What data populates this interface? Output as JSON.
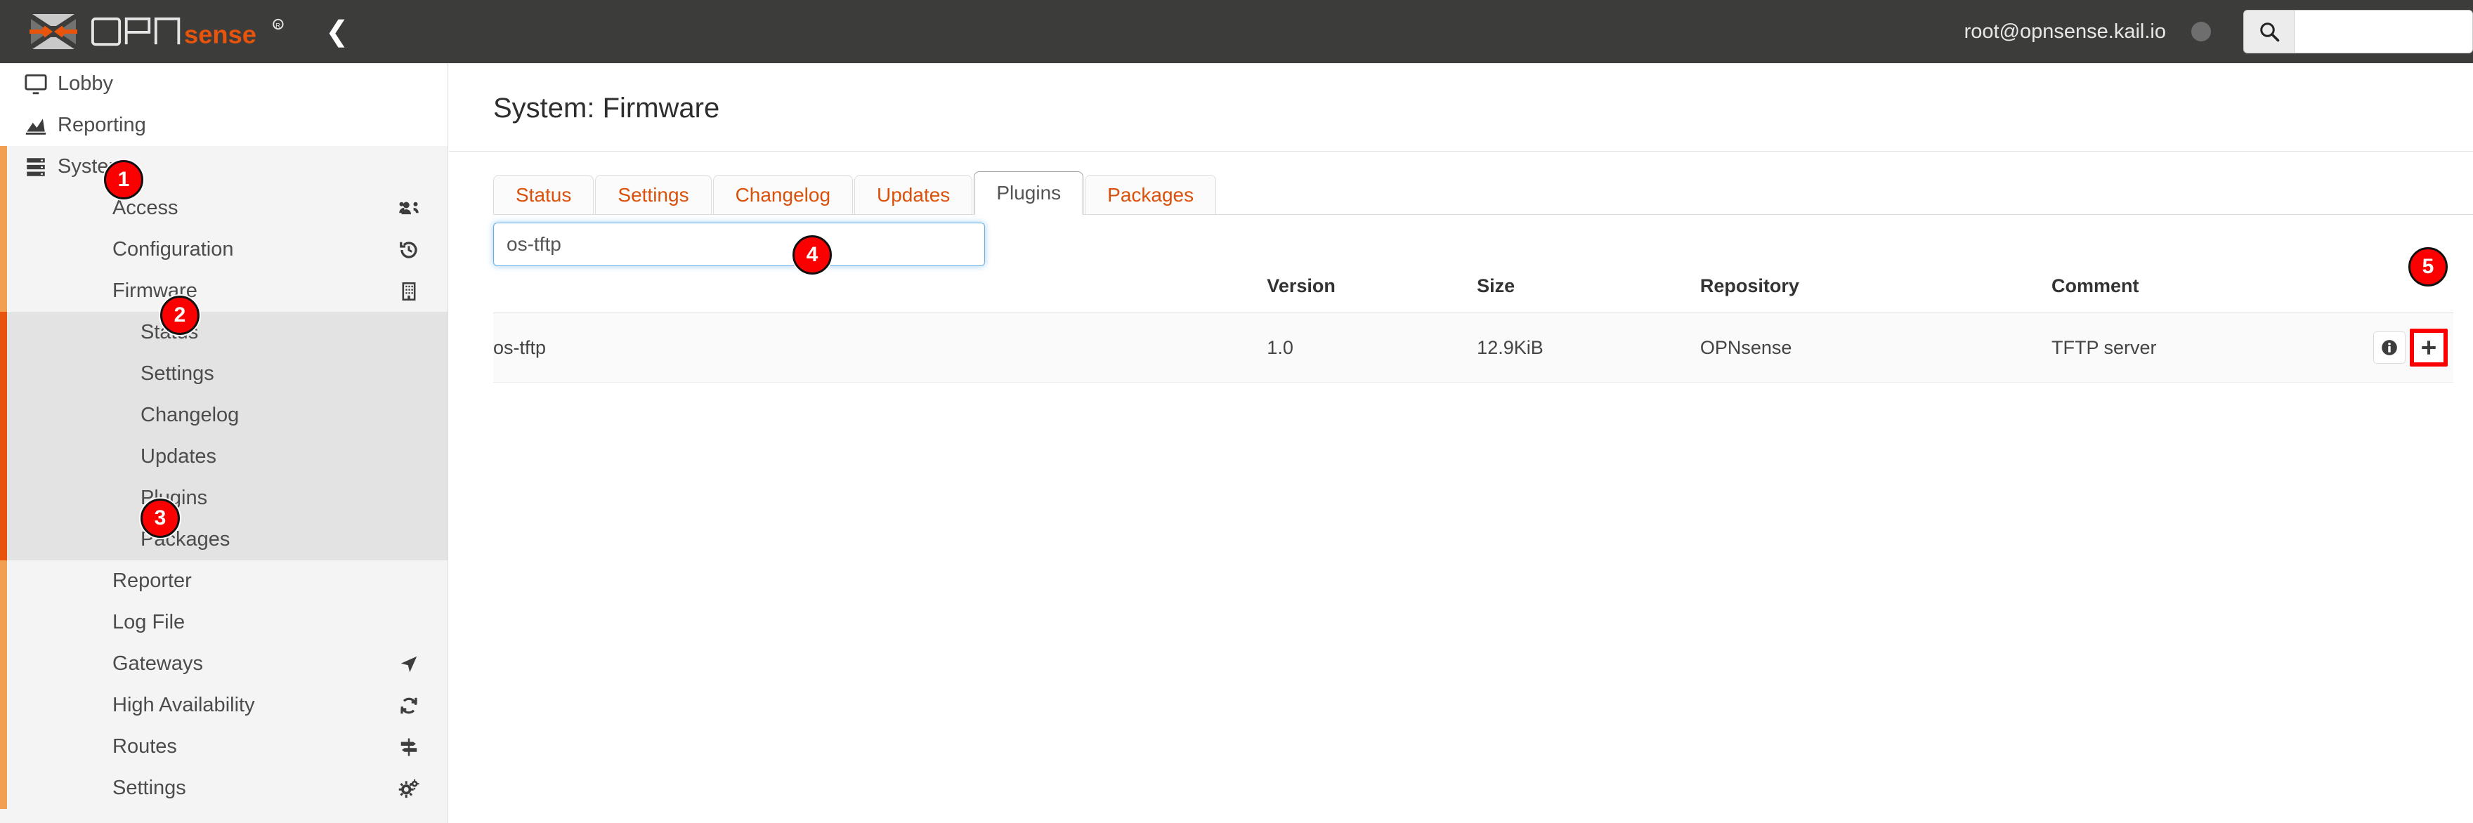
{
  "header": {
    "brand_opn": "OPN",
    "brand_sense": "sense",
    "brand_reg": "®",
    "collapse_icon": "chevron-left-icon",
    "user": "root@opnsense.kail.io",
    "status_indicator": "status-dot",
    "search_icon": "search-icon",
    "search_value": "",
    "search_placeholder": ""
  },
  "sidebar": {
    "items": [
      {
        "label": "Lobby",
        "level": 0,
        "icon": "desktop-icon",
        "right_icon": "",
        "bg": "white",
        "accent": "none"
      },
      {
        "label": "Reporting",
        "level": 0,
        "icon": "chart-area-icon",
        "right_icon": "",
        "bg": "white",
        "accent": "none"
      },
      {
        "label": "System",
        "level": 0,
        "icon": "server-icon",
        "right_icon": "",
        "bg": "section",
        "accent": "light"
      },
      {
        "label": "Access",
        "level": 1,
        "icon": "",
        "right_icon": "users-icon",
        "bg": "section",
        "accent": "light"
      },
      {
        "label": "Configuration",
        "level": 1,
        "icon": "",
        "right_icon": "history-icon",
        "bg": "section",
        "accent": "light"
      },
      {
        "label": "Firmware",
        "level": 1,
        "icon": "",
        "right_icon": "building-icon",
        "bg": "section",
        "accent": "light"
      },
      {
        "label": "Status",
        "level": 2,
        "icon": "",
        "right_icon": "",
        "bg": "sub",
        "accent": "strong"
      },
      {
        "label": "Settings",
        "level": 2,
        "icon": "",
        "right_icon": "",
        "bg": "sub",
        "accent": "strong"
      },
      {
        "label": "Changelog",
        "level": 2,
        "icon": "",
        "right_icon": "",
        "bg": "sub",
        "accent": "strong"
      },
      {
        "label": "Updates",
        "level": 2,
        "icon": "",
        "right_icon": "",
        "bg": "sub",
        "accent": "strong"
      },
      {
        "label": "Plugins",
        "level": 2,
        "icon": "",
        "right_icon": "",
        "bg": "sub",
        "accent": "strong"
      },
      {
        "label": "Packages",
        "level": 2,
        "icon": "",
        "right_icon": "",
        "bg": "sub",
        "accent": "strong"
      },
      {
        "label": "Reporter",
        "level": 1,
        "icon": "",
        "right_icon": "",
        "bg": "section",
        "accent": "light"
      },
      {
        "label": "Log File",
        "level": 1,
        "icon": "",
        "right_icon": "",
        "bg": "section",
        "accent": "light"
      },
      {
        "label": "Gateways",
        "level": 1,
        "icon": "",
        "right_icon": "location-arrow-icon",
        "bg": "section",
        "accent": "light"
      },
      {
        "label": "High Availability",
        "level": 1,
        "icon": "",
        "right_icon": "sync-icon",
        "bg": "section",
        "accent": "light"
      },
      {
        "label": "Routes",
        "level": 1,
        "icon": "",
        "right_icon": "signpost-icon",
        "bg": "section",
        "accent": "light"
      },
      {
        "label": "Settings",
        "level": 1,
        "icon": "",
        "right_icon": "cogs-icon",
        "bg": "section",
        "accent": "light"
      }
    ]
  },
  "main": {
    "page_title": "System: Firmware",
    "tabs": [
      {
        "label": "Status",
        "active": false
      },
      {
        "label": "Settings",
        "active": false
      },
      {
        "label": "Changelog",
        "active": false
      },
      {
        "label": "Updates",
        "active": false
      },
      {
        "label": "Plugins",
        "active": true
      },
      {
        "label": "Packages",
        "active": false
      }
    ],
    "plugin_search": {
      "value": "os-tftp",
      "placeholder": ""
    },
    "table": {
      "headers": [
        "",
        "Version",
        "Size",
        "Repository",
        "Comment",
        ""
      ],
      "rows": [
        {
          "name": "os-tftp",
          "version": "1.0",
          "size": "12.9KiB",
          "repository": "OPNsense",
          "comment": "TFTP server",
          "info_icon": "info-circle-icon",
          "add_icon": "plus-icon"
        }
      ]
    }
  },
  "annotations": [
    {
      "id": "badge1",
      "label": "1"
    },
    {
      "id": "badge2",
      "label": "2"
    },
    {
      "id": "badge3",
      "label": "3"
    },
    {
      "id": "badge4",
      "label": "4"
    },
    {
      "id": "badge5",
      "label": "5"
    }
  ],
  "colors": {
    "brand_orange": "#e8540c",
    "tab_orange": "#d9510b",
    "header_dark": "#3c3c3b",
    "accent_light": "#f0a050",
    "annotation_red": "#fa0000",
    "focus_blue": "#66afe9"
  }
}
